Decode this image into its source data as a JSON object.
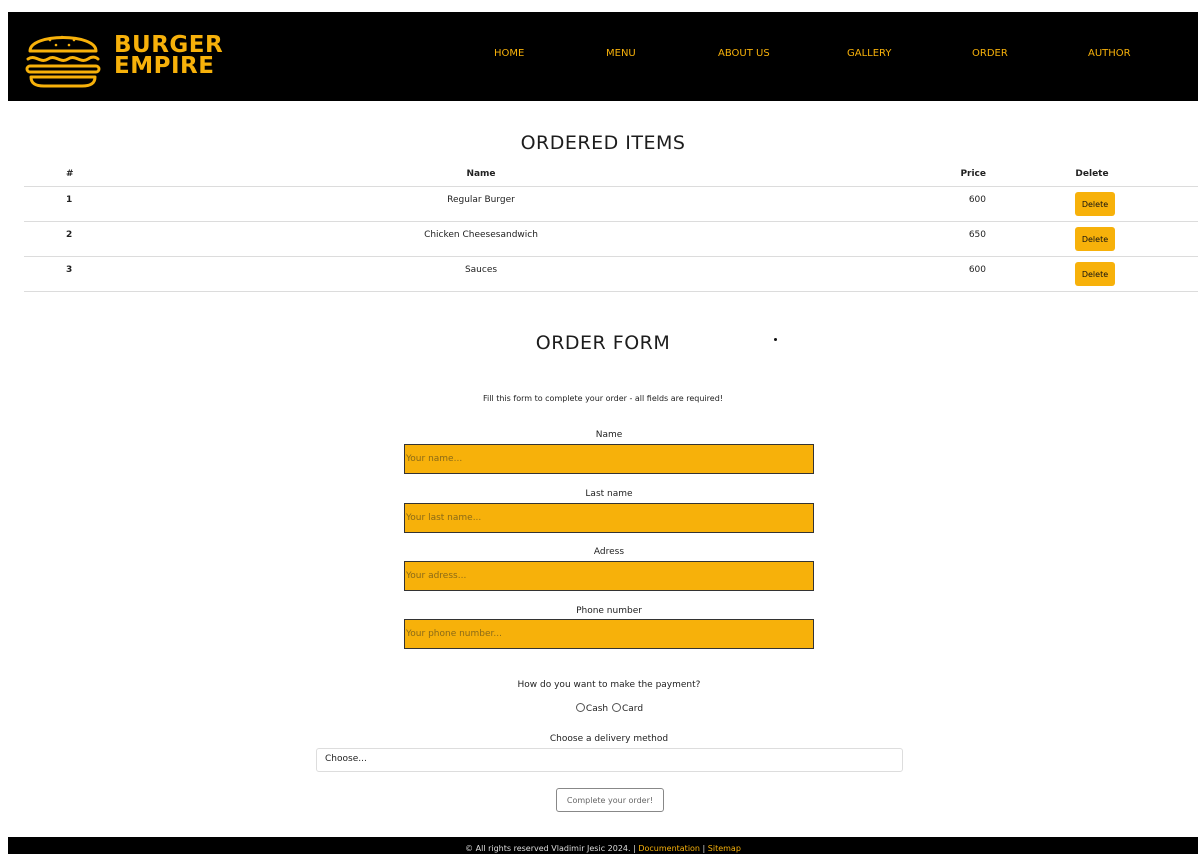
{
  "brand": {
    "line1": "BURGER",
    "line2": "EMPIRE",
    "color": "#f7b10a"
  },
  "nav": [
    "HOME",
    "MENU",
    "ABOUT US",
    "GALLERY",
    "ORDER",
    "AUTHOR"
  ],
  "ordered": {
    "title": "ORDERED ITEMS",
    "headers": {
      "num": "#",
      "name": "Name",
      "price": "Price",
      "del": "Delete"
    },
    "rows": [
      {
        "num": "1",
        "name": "Regular Burger",
        "price": "600",
        "del": "Delete"
      },
      {
        "num": "2",
        "name": "Chicken Cheesesandwich",
        "price": "650",
        "del": "Delete"
      },
      {
        "num": "3",
        "name": "Sauces",
        "price": "600",
        "del": "Delete"
      }
    ]
  },
  "form": {
    "title": "ORDER FORM",
    "intro": "Fill this form to complete your order - all fields are required!",
    "name_label": "Name",
    "name_ph": "Your name...",
    "last_label": "Last name",
    "last_ph": "Your last name...",
    "adress_label": "Adress",
    "adress_ph": "Your adress...",
    "phone_label": "Phone number",
    "phone_ph": "Your phone number...",
    "payment_question": "How do you want to make the payment?",
    "cash": "Cash",
    "card": "Card",
    "delivery_label": "Choose a delivery method",
    "delivery_selected": "Choose...",
    "submit": "Complete your order!"
  },
  "footer": {
    "text": "© All rights reserved Vladimir Jesic 2024. | ",
    "doc": "Documentation",
    "sep": " | ",
    "sitemap": "Sitemap"
  }
}
